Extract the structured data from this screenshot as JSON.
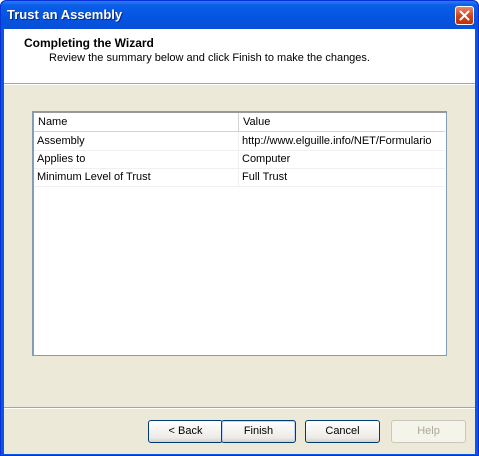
{
  "window": {
    "title": "Trust an Assembly"
  },
  "header": {
    "title": "Completing the Wizard",
    "subtitle": "Review the summary below and click Finish to make the changes."
  },
  "summary_list": {
    "columns": [
      "Name",
      "Value"
    ],
    "rows": [
      {
        "name": "Assembly",
        "value": "http://www.elguille.info/NET/Formulario"
      },
      {
        "name": "Applies to",
        "value": "Computer"
      },
      {
        "name": "Minimum Level of Trust",
        "value": "Full Trust"
      }
    ]
  },
  "buttons": {
    "back": "< Back",
    "finish": "Finish",
    "cancel": "Cancel",
    "help": "Help"
  }
}
